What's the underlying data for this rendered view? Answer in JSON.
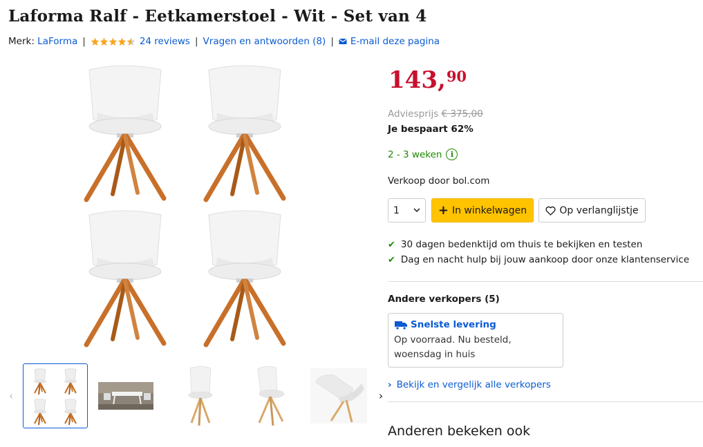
{
  "product": {
    "title": "Laforma Ralf - Eetkamerstoel - Wit - Set van 4",
    "brand_label": "Merk:",
    "brand": "LaForma",
    "rating": 4.5,
    "reviews": "24 reviews",
    "qa": "Vragen en antwoorden (8)",
    "email": "E-mail deze pagina"
  },
  "gallery": {
    "thumbnails": [
      "chairs-set-of-4",
      "dining-room-table",
      "chair-front",
      "chair-angle",
      "chair-tilted"
    ]
  },
  "pricing": {
    "price_main": "143,",
    "price_cents": "90",
    "advies_label": "Adviesprijs",
    "advies_price": "€ 375,00",
    "saving": "Je bespaart 62%",
    "delivery": "2 - 3 weken",
    "seller": "Verkoop door bol.com"
  },
  "actions": {
    "quantity": "1",
    "cart_label": "In winkelwagen",
    "wishlist_label": "Op verlanglijstje"
  },
  "usps": [
    "30 dagen bedenktijd om thuis te bekijken en testen",
    "Dag en nacht hulp bij jouw aankoop door onze klantenservice"
  ],
  "other_sellers": {
    "title": "Andere verkopers (5)",
    "fast_label": "Snelste levering",
    "fast_text": "Op voorraad. Nu besteld, woensdag in huis",
    "compare": "Bekijk en vergelijk alle verkopers"
  },
  "also_viewed": "Anderen bekeken ook",
  "colors": {
    "price": "#c8102e",
    "link": "#0a5bd3",
    "green": "#1e8a00",
    "cart": "#ffc300",
    "star": "#f5a623"
  }
}
